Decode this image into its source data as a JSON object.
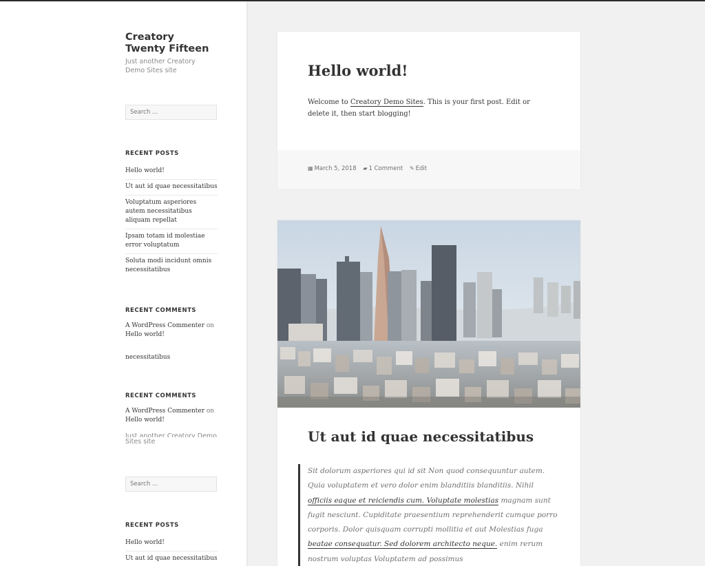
{
  "site": {
    "title": "Creatory Twenty Fifteen",
    "description": "Just another Creatory Demo Sites site"
  },
  "search": {
    "placeholder": "Search …"
  },
  "widgets": {
    "recent_posts_title": "RECENT POSTS",
    "recent_posts": [
      "Hello world!",
      "Ut aut id quae necessitatibus",
      "Voluptatum asperiores autem necessitatibus aliquam repellat",
      "Ipsam totam id molestiae error voluptatum",
      "Soluta modi incidunt omnis necessitatibus"
    ],
    "recent_comments_title": "RECENT COMMENTS",
    "comment": {
      "author": "A WordPress Commenter",
      "on": "on",
      "post": "Hello world!"
    },
    "orphan_text": "necessitatibus",
    "faded_desc_1": "Just another Creatory Demo",
    "faded_desc_2": "Sites site",
    "recent_posts_2": [
      "Hello world!",
      "Ut aut id quae necessitatibus"
    ]
  },
  "post1": {
    "title": "Hello world!",
    "excerpt_pre": "Welcome to ",
    "excerpt_link": "Creatory Demo Sites",
    "excerpt_post": ". This is your first post. Edit or delete it, then start blogging!",
    "date": "March 5, 2018",
    "comments": "1 Comment",
    "edit": "Edit"
  },
  "post2": {
    "title": "Ut aut id quae necessitatibus",
    "quote": {
      "t1": "Sit dolorum asperiores qui id sit Non quod consequuntur autem. Quia voluptatem et vero dolor enim blanditiis blanditiis. Nihil ",
      "l1": "officiis eaque et reiciendis cum. Voluptate molestias",
      "t2": " magnam sunt fugit nesciunt. Cupiditate praesentium reprehenderit cumque porro corporis. Dolor quisquam corrupti mollitia et aut Molestias fuga ",
      "l2": "beatae consequatur. Sed dolorem architecto neque.",
      "t3": " enim rerum nostrum voluptas Voluptatem ad possimus"
    }
  },
  "colors": {
    "background": "#f1f1f1",
    "card": "#ffffff",
    "footer": "#f7f7f7",
    "text": "#333333",
    "muted": "#707070"
  }
}
